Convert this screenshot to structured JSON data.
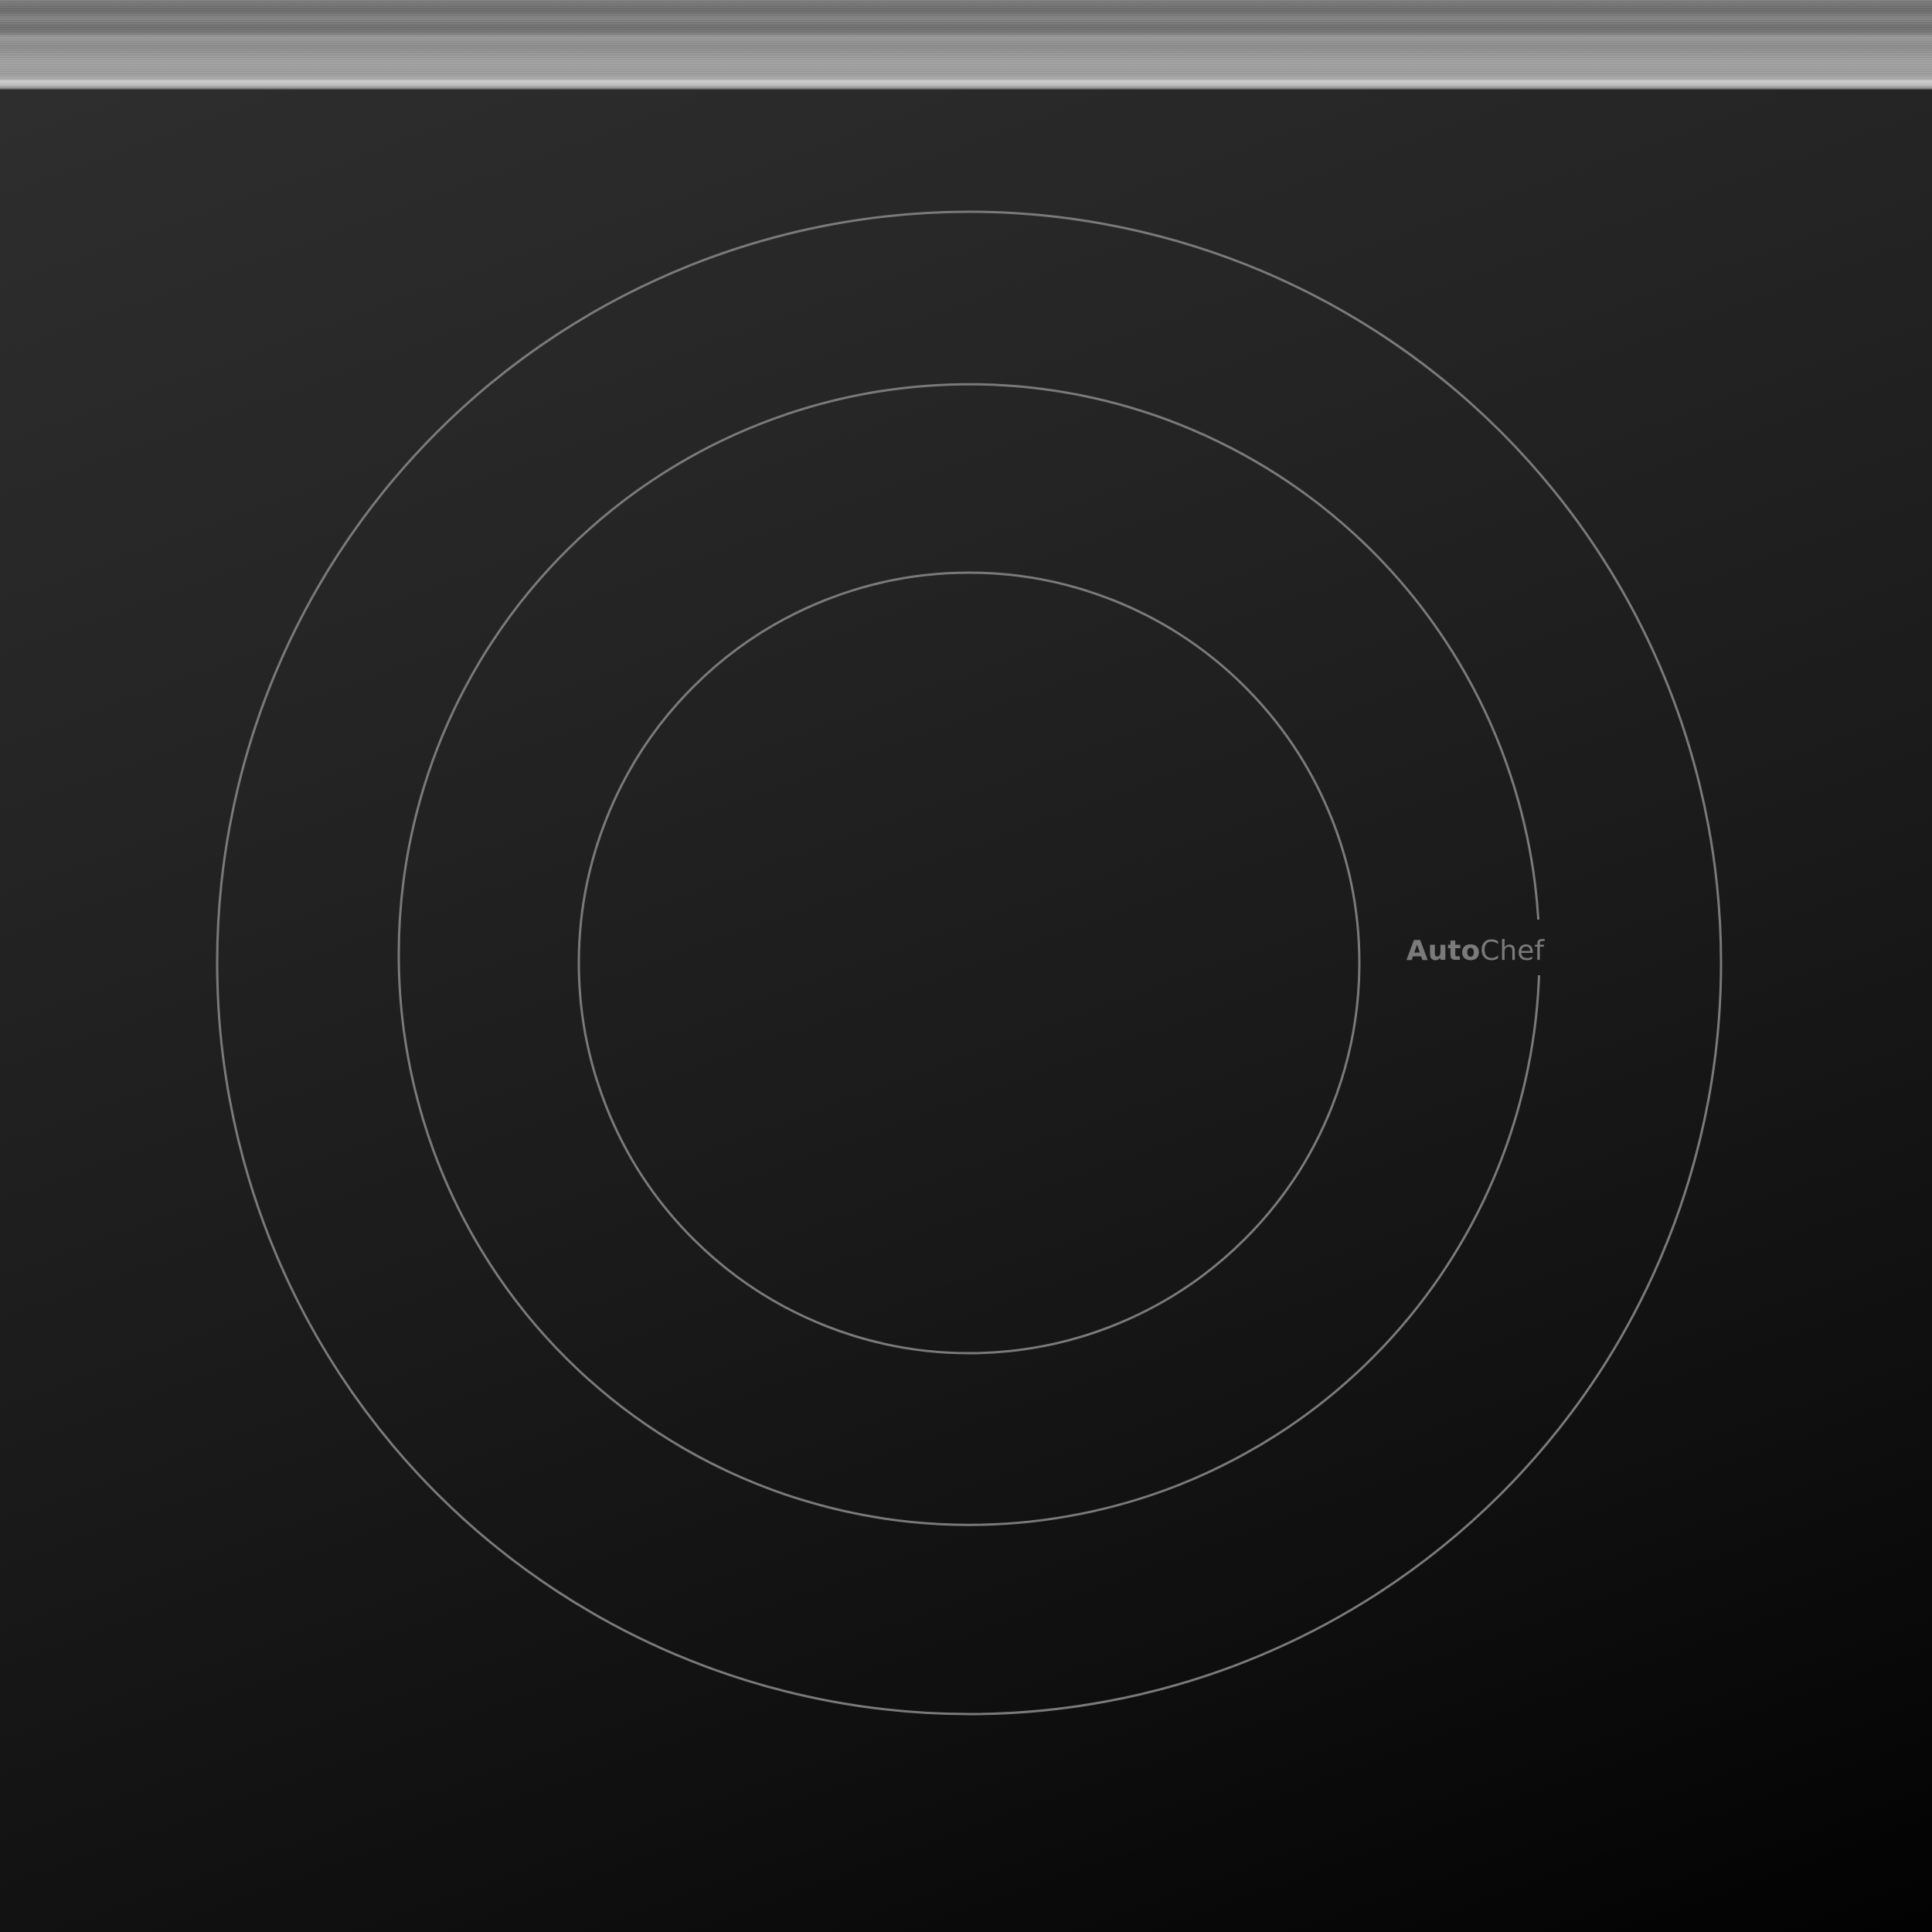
{
  "brand": {
    "bold_part": "Auto",
    "light_part": "Chef"
  },
  "colors": {
    "ring_stroke": "#7a7a7a",
    "logo": "#7a7a7a",
    "glass_top": "#2e2e2e",
    "glass_bottom": "#020202",
    "steel_trim": "#a3a3a3"
  },
  "cooking_zones": [
    {
      "name": "inner-zone"
    },
    {
      "name": "middle-zone"
    },
    {
      "name": "outer-zone"
    }
  ]
}
